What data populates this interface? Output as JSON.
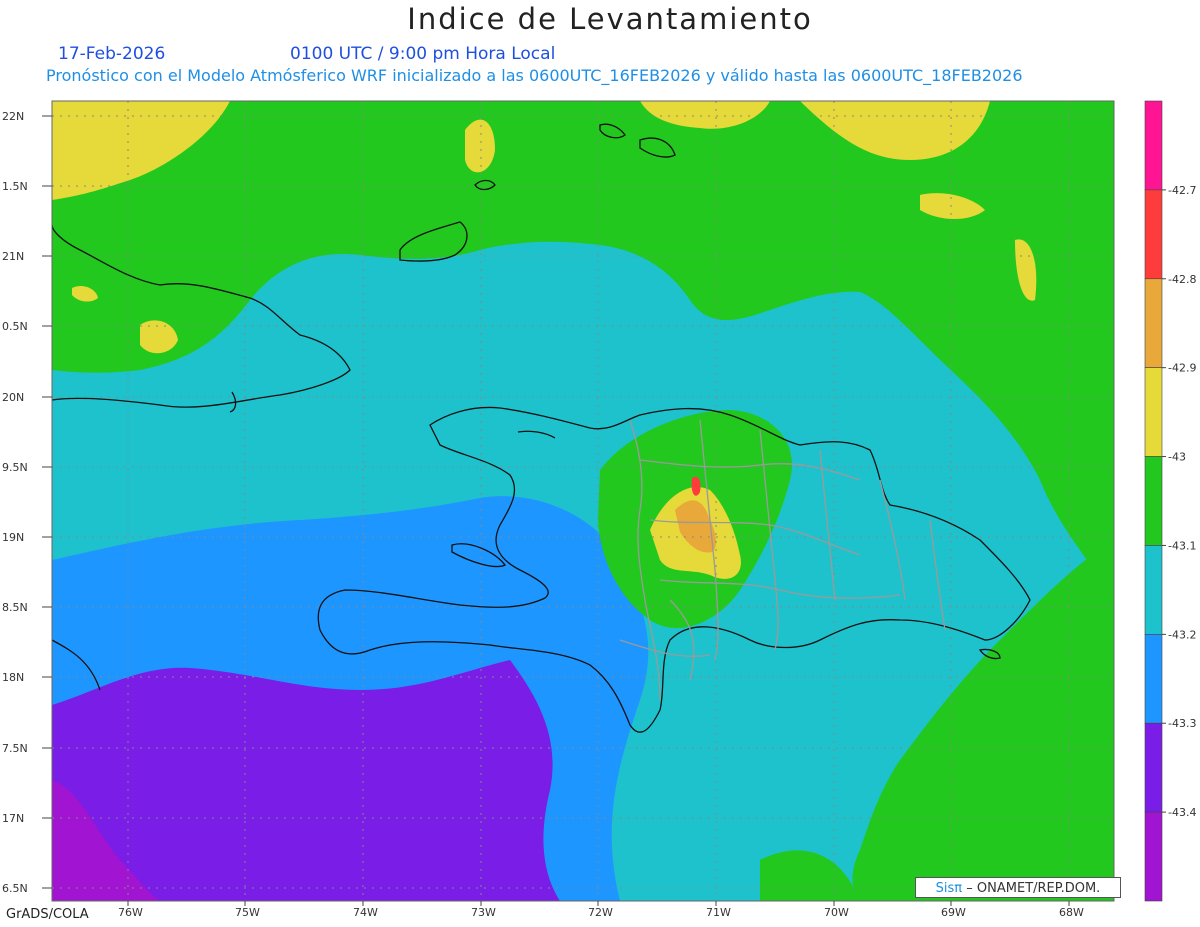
{
  "title": "Indice de Levantamiento",
  "date": "17-Feb-2026",
  "time_label": "0100 UTC / 9:00 pm Hora Local",
  "model_line": "Pronóstico con el Modelo Atmósferico WRF inicializado a las 0600UTC_16FEB2026 y válido hasta las  0600UTC_18FEB2026",
  "credit": {
    "brand": "Sisπ",
    "text": "– ONAMET/REP.DOM."
  },
  "footer": "GrADS/COLA",
  "lat_labels": [
    "22N",
    "1.5N",
    "21N",
    "0.5N",
    "20N",
    "9.5N",
    "19N",
    "8.5N",
    "18N",
    "7.5N",
    "17N",
    "6.5N"
  ],
  "lon_labels": [
    "76W",
    "75W",
    "74W",
    "73W",
    "72W",
    "71W",
    "70W",
    "69W",
    "68W"
  ],
  "colorbar": {
    "colors": [
      "#ff1493",
      "#ff3c3c",
      "#e8a83a",
      "#e6d93a",
      "#22c81e",
      "#1ec2cc",
      "#1e96ff",
      "#7a1de6",
      "#a014d2"
    ],
    "labels": [
      "-42.7",
      "-42.8",
      "-42.9",
      "-43",
      "-43.1",
      "-43.2",
      "-43.3",
      "-43.4"
    ]
  }
}
